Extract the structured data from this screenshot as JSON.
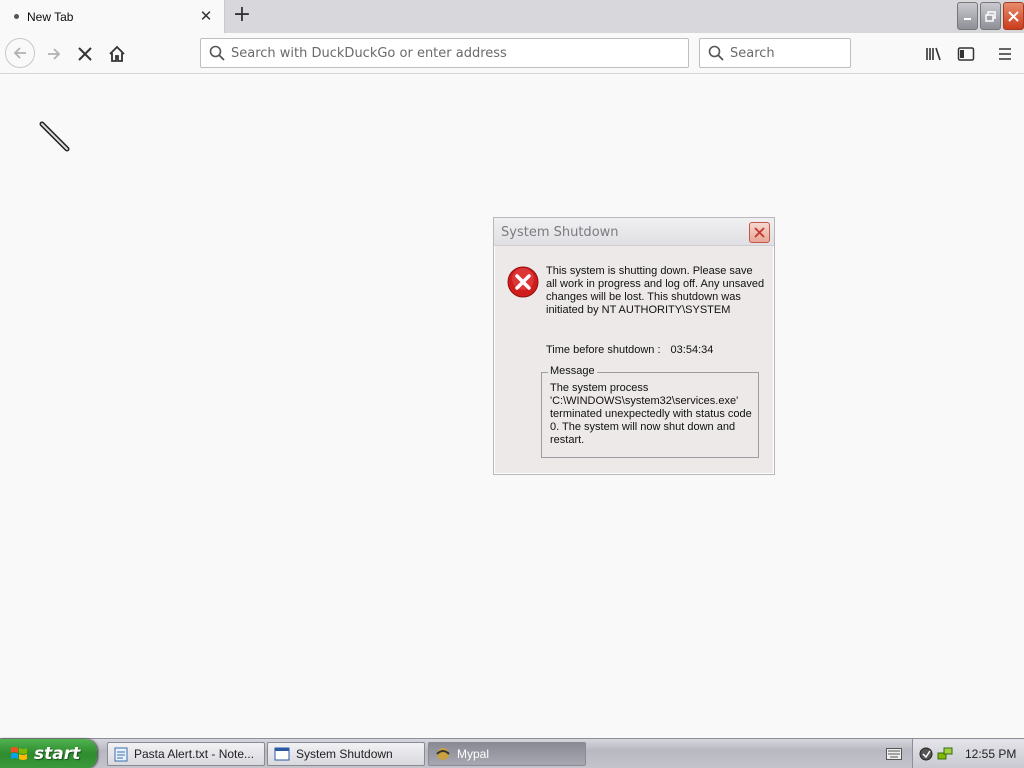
{
  "browser": {
    "tab": {
      "title": "New Tab"
    },
    "newtab_icon": "plus-icon",
    "urlbar": {
      "placeholder": "Search with DuckDuckGo or enter address"
    },
    "searchbar": {
      "placeholder": "Search"
    }
  },
  "dialog": {
    "title": "System Shutdown",
    "body": "This system is shutting down. Please save all work in progress and log off. Any unsaved changes will be lost. This shutdown was initiated by NT AUTHORITY\\SYSTEM",
    "time_label": "Time before shutdown :",
    "time_value": "03:54:34",
    "message_label": "Message",
    "message_text": "The system process 'C:\\WINDOWS\\system32\\services.exe' terminated unexpectedly with status code 0.  The system will now shut down and restart."
  },
  "taskbar": {
    "start_label": "start",
    "tasks": [
      {
        "label": "Pasta Alert.txt - Note..."
      },
      {
        "label": "System Shutdown"
      },
      {
        "label": "Mypal"
      }
    ],
    "clock": "12:55 PM"
  },
  "colors": {
    "accent_green": "#3c9b3c",
    "error_red": "#d11c1c"
  }
}
